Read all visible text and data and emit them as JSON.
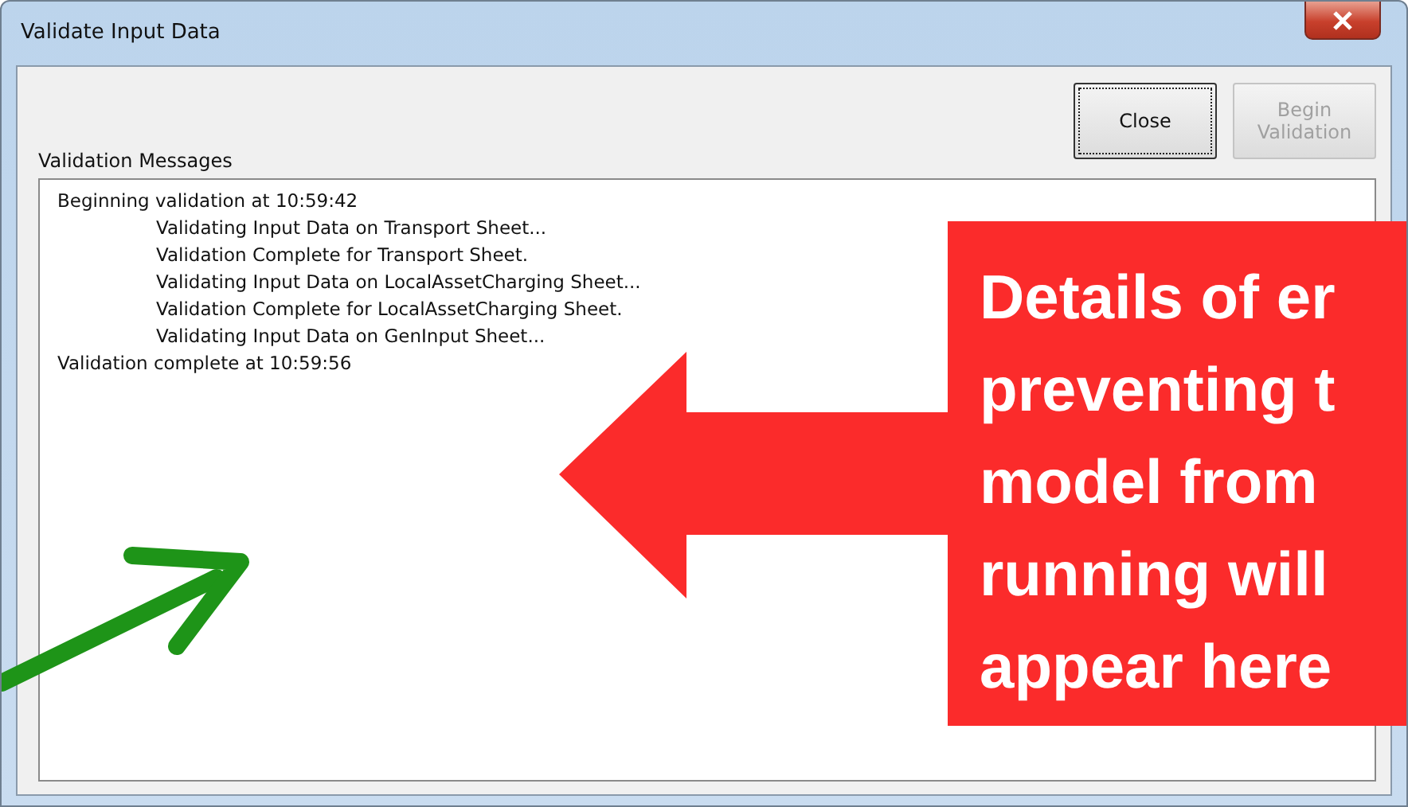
{
  "window": {
    "title": "Validate Input Data"
  },
  "buttons": [
    {
      "label": "Close",
      "disabled": false
    },
    {
      "label": "Begin Validation",
      "disabled": true
    }
  ],
  "messages_label": "Validation Messages",
  "messages": [
    {
      "text": "Beginning validation at 10:59:42",
      "children": [
        {
          "text": "Validating Input Data on Transport Sheet..."
        },
        {
          "text": "Validation Complete for Transport Sheet."
        },
        {
          "text": "Validating Input Data on LocalAssetCharging Sheet..."
        },
        {
          "text": "Validation Complete for LocalAssetCharging Sheet."
        },
        {
          "text": "Validating Input Data on GenInput Sheet..."
        }
      ]
    },
    {
      "text": "Validation complete at 10:59:56"
    }
  ],
  "annotation": {
    "lines": [
      "Details of er",
      "preventing t",
      "model from",
      "running will",
      "appear here"
    ]
  }
}
